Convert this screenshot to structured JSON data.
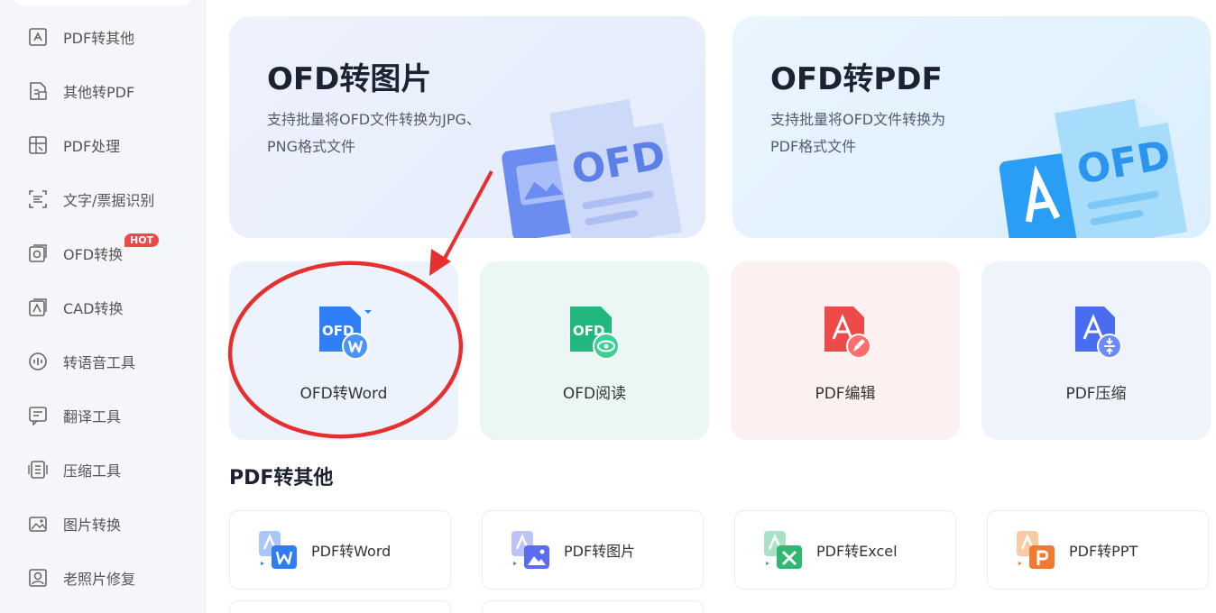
{
  "sidebar": {
    "items": [
      {
        "label": "PDF转其他",
        "icon": "pdf-convert-icon"
      },
      {
        "label": "其他转PDF",
        "icon": "to-pdf-icon"
      },
      {
        "label": "PDF处理",
        "icon": "pdf-process-icon"
      },
      {
        "label": "文字/票据识别",
        "icon": "ocr-icon"
      },
      {
        "label": "OFD转换",
        "icon": "ofd-convert-icon",
        "badge": "HOT"
      },
      {
        "label": "CAD转换",
        "icon": "cad-icon"
      },
      {
        "label": "转语音工具",
        "icon": "voice-icon"
      },
      {
        "label": "翻译工具",
        "icon": "translate-icon"
      },
      {
        "label": "压缩工具",
        "icon": "compress-icon"
      },
      {
        "label": "图片转换",
        "icon": "image-convert-icon"
      },
      {
        "label": "老照片修复",
        "icon": "photo-repair-icon"
      }
    ]
  },
  "banners": [
    {
      "title": "OFD转图片",
      "desc": "支持批量将OFD文件转换为JPG、PNG格式文件",
      "art_text": "OFD"
    },
    {
      "title": "OFD转PDF",
      "desc": "支持批量将OFD文件转换为PDF格式文件",
      "art_text": "OFD"
    }
  ],
  "tiles": [
    {
      "label": "OFD转Word",
      "icon_text": "OFD"
    },
    {
      "label": "OFD阅读",
      "icon_text": "OFD"
    },
    {
      "label": "PDF编辑"
    },
    {
      "label": "PDF压缩"
    }
  ],
  "section": {
    "title": "PDF转其他"
  },
  "tools": [
    {
      "label": "PDF转Word",
      "color": "#2f7ef5"
    },
    {
      "label": "PDF转图片",
      "color": "#5b6cf0"
    },
    {
      "label": "PDF转Excel",
      "color": "#2fb872"
    },
    {
      "label": "PDF转PPT",
      "color": "#f07a30"
    }
  ],
  "colors": {
    "accent": "#2f7ef5",
    "annotation": "#e63030",
    "hot": "#f04848"
  }
}
